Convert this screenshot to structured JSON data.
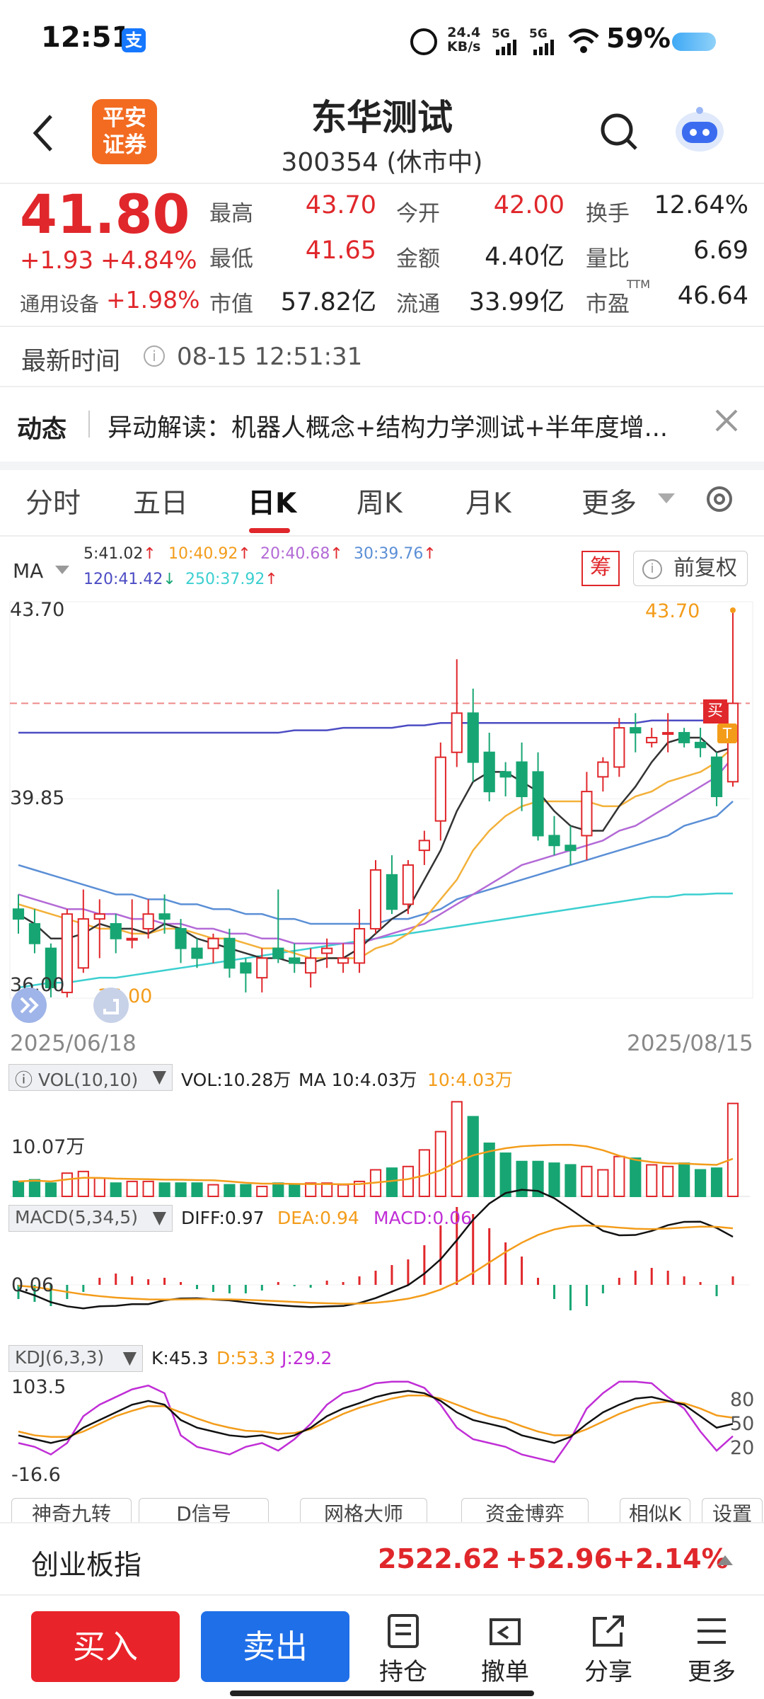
{
  "status": {
    "time": "12:51",
    "net_speed_top": "24.4",
    "net_speed_bottom": "KB/s",
    "sig1": "5G",
    "sig2": "5G",
    "battery": "59%"
  },
  "header": {
    "logo_line1": "平安",
    "logo_line2": "证券",
    "title": "东华测试",
    "code": "300354",
    "state": "(休市中)"
  },
  "quote": {
    "price": "41.80",
    "change": "+1.93",
    "change_pct": "+4.84%",
    "sector": "通用设备",
    "sector_pct": "+1.98%",
    "cells": [
      {
        "label": "最高",
        "value": "43.70",
        "color": "red"
      },
      {
        "label": "今开",
        "value": "42.00",
        "color": "red"
      },
      {
        "label": "换手",
        "value": "12.64%",
        "color": "dark"
      },
      {
        "label": "最低",
        "value": "41.65",
        "color": "red"
      },
      {
        "label": "金额",
        "value": "4.40亿",
        "color": "dark"
      },
      {
        "label": "量比",
        "value": "6.69",
        "color": "dark"
      },
      {
        "label": "市值",
        "value": "57.82亿",
        "color": "dark"
      },
      {
        "label": "流通",
        "value": "33.99亿",
        "color": "dark"
      },
      {
        "label": "市盈",
        "value": "46.64",
        "color": "dark",
        "sup": "TTM"
      }
    ]
  },
  "update": {
    "label": "最新时间",
    "time": "08-15 12:51:31"
  },
  "news": {
    "tag": "动态",
    "text": "异动解读：机器人概念+结构力学测试+半年度增..."
  },
  "tabs": [
    "分时",
    "五日",
    "日K",
    "周K",
    "月K",
    "更多"
  ],
  "active_tab": "日K",
  "ma": {
    "label": "MA",
    "items": [
      {
        "text": "5:41.02",
        "arrow": "↑",
        "color": "#333",
        "arrow_color": "#e0272b"
      },
      {
        "text": "10:40.92",
        "arrow": "↑",
        "color": "#f39c1a",
        "arrow_color": "#e0272b"
      },
      {
        "text": "20:40.68",
        "arrow": "↑",
        "color": "#b36ad6",
        "arrow_color": "#e0272b"
      },
      {
        "text": "30:39.76",
        "arrow": "↑",
        "color": "#5b8fd6",
        "arrow_color": "#e0272b"
      },
      {
        "text": "120:41.42",
        "arrow": "↓",
        "color": "#4c4cc4",
        "arrow_color": "#17a673"
      },
      {
        "text": "250:37.92",
        "arrow": "↑",
        "color": "#3ccfd0",
        "arrow_color": "#e0272b"
      }
    ],
    "chou": "筹",
    "fuquan": "前复权"
  },
  "kline": {
    "high_label": "43.70",
    "mid_label": "39.85",
    "low_label": "36.00",
    "high_mark": "43.70",
    "low_mark": "36.00",
    "date_start": "2025/06/18",
    "date_end": "2025/08/15",
    "buy_tag": "买",
    "t_tag": "T"
  },
  "vol": {
    "selector": "VOL(10,10)",
    "text1": "VOL:10.28万",
    "text2": "MA 10:4.03万",
    "text3": "10:4.03万",
    "axis": "10.07万"
  },
  "macd": {
    "selector": "MACD(5,34,5)",
    "diff": "DIFF:0.97",
    "dea": "DEA:0.94",
    "macd": "MACD:0.06",
    "axis": "0.06"
  },
  "kdj": {
    "selector": "KDJ(6,3,3)",
    "k": "K:45.3",
    "d": "D:53.3",
    "j": "J:29.2",
    "top": "103.5",
    "bottom": "-16.6",
    "r80": "80",
    "r50": "50",
    "r20": "20"
  },
  "chips": [
    "神奇九转",
    "D信号",
    "网格大师",
    "资金博弈",
    "相似K",
    "设置"
  ],
  "index": {
    "name": "创业板指",
    "value": "2522.62",
    "change": "+52.96",
    "pct": "+2.14%"
  },
  "bottom": {
    "buy": "买入",
    "sell": "卖出",
    "hold": "持仓",
    "cancel": "撤单",
    "share": "分享",
    "more": "更多"
  },
  "chart_data": {
    "type": "candlestick",
    "x_range": [
      "2025/06/18",
      "2025/08/15"
    ],
    "ylim": [
      36.0,
      43.7
    ],
    "candles": [
      [
        37.6,
        37.9,
        37.1,
        37.4
      ],
      [
        37.3,
        37.6,
        36.7,
        36.9
      ],
      [
        36.8,
        36.9,
        35.8,
        36.0
      ],
      [
        35.9,
        37.6,
        35.8,
        37.5
      ],
      [
        36.4,
        38.0,
        36.3,
        37.4
      ],
      [
        37.4,
        37.8,
        36.6,
        37.5
      ],
      [
        37.3,
        37.5,
        36.7,
        37.0
      ],
      [
        37.0,
        37.8,
        36.8,
        37.0
      ],
      [
        37.2,
        37.8,
        37.0,
        37.5
      ],
      [
        37.5,
        37.9,
        37.1,
        37.4
      ],
      [
        37.2,
        37.4,
        36.5,
        36.8
      ],
      [
        36.8,
        37.0,
        36.4,
        36.6
      ],
      [
        36.8,
        37.1,
        36.5,
        37.0
      ],
      [
        37.0,
        37.2,
        36.2,
        36.4
      ],
      [
        36.5,
        36.6,
        35.9,
        36.3
      ],
      [
        36.2,
        36.8,
        35.9,
        36.6
      ],
      [
        36.8,
        38.0,
        36.5,
        36.6
      ],
      [
        36.6,
        36.9,
        36.3,
        36.5
      ],
      [
        36.3,
        36.8,
        36.0,
        36.6
      ],
      [
        36.7,
        37.0,
        36.4,
        36.8
      ],
      [
        36.5,
        36.9,
        36.3,
        36.6
      ],
      [
        36.5,
        37.6,
        36.3,
        37.2
      ],
      [
        37.2,
        38.6,
        37.1,
        38.4
      ],
      [
        38.3,
        38.7,
        37.5,
        37.6
      ],
      [
        37.7,
        38.6,
        37.5,
        38.5
      ],
      [
        38.8,
        39.2,
        38.5,
        39.0
      ],
      [
        39.4,
        41.0,
        39.0,
        40.7
      ],
      [
        40.8,
        42.7,
        40.5,
        41.6
      ],
      [
        41.6,
        42.1,
        40.2,
        40.6
      ],
      [
        40.8,
        41.2,
        39.8,
        40.0
      ],
      [
        40.4,
        40.6,
        39.9,
        40.3
      ],
      [
        40.6,
        41.0,
        39.6,
        39.9
      ],
      [
        40.4,
        40.8,
        39.0,
        39.1
      ],
      [
        39.1,
        39.5,
        38.7,
        38.9
      ],
      [
        38.9,
        39.3,
        38.5,
        38.8
      ],
      [
        39.1,
        40.4,
        38.6,
        40.0
      ],
      [
        40.3,
        40.7,
        40.0,
        40.6
      ],
      [
        40.5,
        41.5,
        40.3,
        41.3
      ],
      [
        41.3,
        41.6,
        40.8,
        41.2
      ],
      [
        41.0,
        41.3,
        40.9,
        41.1
      ],
      [
        41.2,
        41.6,
        40.8,
        41.2
      ],
      [
        41.2,
        41.3,
        40.9,
        41.0
      ],
      [
        41.0,
        41.3,
        40.7,
        40.9
      ],
      [
        40.7,
        40.8,
        39.7,
        39.9
      ],
      [
        40.2,
        43.7,
        40.1,
        41.8
      ]
    ],
    "ma5": [
      37.5,
      37.3,
      37.0,
      37.0,
      37.1,
      37.3,
      37.2,
      37.2,
      37.1,
      37.3,
      37.2,
      37.0,
      36.9,
      36.8,
      36.7,
      36.6,
      36.6,
      36.5,
      36.5,
      36.6,
      36.6,
      36.8,
      37.1,
      37.4,
      37.6,
      38.2,
      38.8,
      39.6,
      40.2,
      40.4,
      40.4,
      40.2,
      40.0,
      39.6,
      39.3,
      39.2,
      39.2,
      39.7,
      40.1,
      40.6,
      41.0,
      41.1,
      41.1,
      40.8,
      40.9
    ],
    "ma10": [
      37.7,
      37.6,
      37.5,
      37.4,
      37.3,
      37.2,
      37.2,
      37.1,
      37.1,
      37.2,
      37.2,
      37.1,
      37.0,
      37.0,
      36.9,
      36.8,
      36.8,
      36.7,
      36.6,
      36.6,
      36.6,
      36.6,
      36.8,
      36.9,
      37.1,
      37.4,
      37.8,
      38.2,
      38.8,
      39.2,
      39.5,
      39.7,
      39.8,
      39.8,
      39.8,
      39.8,
      39.7,
      39.7,
      39.9,
      40.0,
      40.2,
      40.3,
      40.4,
      40.6,
      40.9
    ],
    "ma20": [
      37.9,
      37.8,
      37.7,
      37.6,
      37.6,
      37.5,
      37.5,
      37.4,
      37.4,
      37.3,
      37.3,
      37.2,
      37.2,
      37.1,
      37.1,
      37.0,
      37.0,
      36.9,
      36.9,
      36.9,
      36.9,
      36.9,
      37.0,
      37.1,
      37.2,
      37.3,
      37.5,
      37.7,
      37.9,
      38.1,
      38.3,
      38.5,
      38.6,
      38.7,
      38.8,
      38.9,
      39.0,
      39.2,
      39.3,
      39.5,
      39.7,
      39.9,
      40.1,
      40.3,
      40.7
    ],
    "ma30": [
      38.5,
      38.4,
      38.3,
      38.2,
      38.1,
      38.0,
      37.9,
      37.9,
      37.8,
      37.8,
      37.7,
      37.7,
      37.6,
      37.6,
      37.5,
      37.5,
      37.4,
      37.4,
      37.3,
      37.3,
      37.3,
      37.3,
      37.3,
      37.4,
      37.4,
      37.5,
      37.6,
      37.8,
      37.9,
      38.0,
      38.1,
      38.2,
      38.3,
      38.4,
      38.5,
      38.6,
      38.7,
      38.8,
      38.9,
      39.0,
      39.1,
      39.3,
      39.4,
      39.5,
      39.8
    ],
    "ma120": [
      41.2,
      41.2,
      41.2,
      41.2,
      41.2,
      41.2,
      41.2,
      41.2,
      41.2,
      41.2,
      41.2,
      41.2,
      41.2,
      41.2,
      41.2,
      41.2,
      41.2,
      41.25,
      41.25,
      41.25,
      41.3,
      41.3,
      41.3,
      41.3,
      41.35,
      41.35,
      41.4,
      41.4,
      41.4,
      41.4,
      41.4,
      41.4,
      41.4,
      41.4,
      41.4,
      41.4,
      41.4,
      41.4,
      41.4,
      41.45,
      41.45,
      41.45,
      41.45,
      41.45,
      41.42
    ],
    "ma250": [
      36.0,
      36.05,
      36.1,
      36.1,
      36.15,
      36.2,
      36.2,
      36.25,
      36.3,
      36.35,
      36.4,
      36.45,
      36.5,
      36.55,
      36.6,
      36.65,
      36.7,
      36.75,
      36.8,
      36.85,
      36.9,
      36.95,
      37.0,
      37.05,
      37.1,
      37.15,
      37.2,
      37.25,
      37.3,
      37.35,
      37.4,
      37.45,
      37.5,
      37.55,
      37.6,
      37.65,
      37.7,
      37.75,
      37.8,
      37.85,
      37.85,
      37.9,
      37.9,
      37.92,
      37.92
    ],
    "volume": [
      0.9,
      1.0,
      0.8,
      1.4,
      1.5,
      1.1,
      0.8,
      0.9,
      0.9,
      0.8,
      0.8,
      0.8,
      0.7,
      0.7,
      0.7,
      0.6,
      0.8,
      0.7,
      0.8,
      0.8,
      0.7,
      0.9,
      1.6,
      1.7,
      1.8,
      2.8,
      3.9,
      5.7,
      4.8,
      3.2,
      2.6,
      2.1,
      2.1,
      2.0,
      1.9,
      1.8,
      1.6,
      2.4,
      2.3,
      1.9,
      1.8,
      2.0,
      1.6,
      1.7,
      5.6
    ],
    "macd_bars": [
      -0.1,
      -0.12,
      -0.15,
      -0.1,
      -0.05,
      0.05,
      0.08,
      0.06,
      0.04,
      0.05,
      0.02,
      -0.03,
      -0.05,
      -0.06,
      -0.06,
      -0.04,
      0.02,
      -0.01,
      -0.02,
      0.03,
      0.02,
      0.06,
      0.1,
      0.14,
      0.18,
      0.28,
      0.42,
      0.55,
      0.5,
      0.4,
      0.3,
      0.2,
      0.05,
      -0.1,
      -0.18,
      -0.15,
      -0.06,
      0.05,
      0.1,
      0.12,
      0.1,
      0.06,
      0.02,
      -0.08,
      0.06
    ],
    "kdj_k": [
      30,
      25,
      20,
      25,
      40,
      50,
      60,
      70,
      75,
      70,
      50,
      40,
      35,
      30,
      28,
      30,
      25,
      30,
      40,
      55,
      65,
      72,
      80,
      85,
      88,
      85,
      75,
      60,
      50,
      45,
      40,
      30,
      25,
      20,
      28,
      45,
      60,
      70,
      78,
      80,
      75,
      70,
      55,
      40,
      45
    ],
    "kdj_d": [
      35,
      30,
      28,
      28,
      35,
      45,
      55,
      62,
      68,
      68,
      60,
      52,
      45,
      40,
      36,
      35,
      32,
      33,
      38,
      48,
      58,
      66,
      72,
      78,
      82,
      82,
      78,
      70,
      62,
      55,
      50,
      42,
      35,
      30,
      30,
      38,
      48,
      58,
      66,
      72,
      74,
      72,
      65,
      56,
      53
    ],
    "kdj_j": [
      20,
      15,
      5,
      20,
      55,
      70,
      80,
      90,
      95,
      85,
      30,
      15,
      10,
      5,
      15,
      20,
      10,
      25,
      45,
      70,
      85,
      90,
      98,
      100,
      100,
      92,
      70,
      40,
      25,
      20,
      15,
      5,
      0,
      -5,
      25,
      65,
      85,
      100,
      100,
      98,
      80,
      65,
      35,
      10,
      29
    ]
  }
}
